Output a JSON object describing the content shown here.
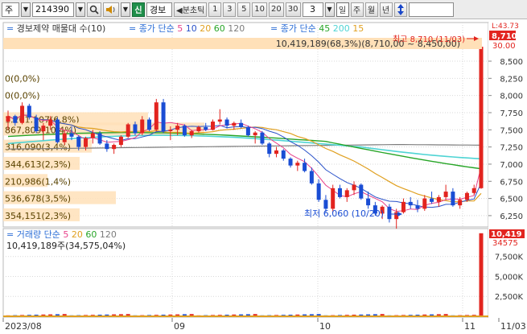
{
  "toolbar": {
    "market_label": "주",
    "stock_code": "214390",
    "sin_label": "신",
    "name_label": "경보",
    "period_label": "◀분초틱",
    "period_buttons": [
      "1",
      "3",
      "5",
      "10",
      "20",
      "30"
    ],
    "interval_value": "3",
    "interval_unit": "일",
    "freq_buttons": [
      "주",
      "월",
      "년"
    ],
    "updown_icon": "up-down-arrow-icon"
  },
  "price_panel": {
    "legend_title": "경보제약 매물대 수(10)",
    "legend_ma_label": "종가 단순",
    "legend_ma_periods": [
      "5",
      "10",
      "20",
      "60",
      "120"
    ],
    "legend_ma2_label": "종가 단순",
    "legend_ma2_periods": [
      "45",
      "200",
      "15"
    ],
    "summary": "10,419,189(68,3%)(8,710,00 ~ 8,450,00)",
    "volume_profile_labels": [
      "0(0,0%)",
      "0(0,0%)",
      "1,201,107(6,8%)",
      "867,809(10,4%)",
      "316,090(3,4%)",
      "344,613(2,3%)",
      "210,986(1,4%)",
      "536,678(3,5%)",
      "354,151(2,3%)"
    ],
    "high_annotation": "최고 8,710 (11/03)",
    "low_annotation": "최저 6,060 (10/20)",
    "top_right_label": "L:43.73",
    "last_price_badge": "8,710",
    "prev_badge": "30.00",
    "y_ticks": [
      "8,500",
      "8,250",
      "8,000",
      "7,750",
      "7,500",
      "7,250",
      "7,000",
      "6,750",
      "6,500",
      "6,250"
    ]
  },
  "volume_panel": {
    "legend_title": "거래량",
    "legend_ma_label": "단순",
    "legend_ma_periods": [
      "5",
      "20",
      "60",
      "120"
    ],
    "summary": "10,419,189주(34,575,04%)",
    "badge_top": "10,419",
    "badge_bottom": "34575",
    "y_ticks": [
      "7,500K",
      "5,000K",
      "2,500K"
    ]
  },
  "x_axis": {
    "labels": [
      "2023/08",
      "09",
      "10",
      "11",
      "11/03"
    ]
  },
  "colors": {
    "up": "#e2241f",
    "down": "#1a4dd4",
    "ma5": "#e8418a",
    "ma10": "#2a52c9",
    "ma20": "#e0a020",
    "ma60": "#27a527",
    "ma120": "#7c7c7c",
    "ma45": "#4fd4d4",
    "legend_label": "#2c6ed6",
    "volume_profile": "#ffe0b8"
  }
}
